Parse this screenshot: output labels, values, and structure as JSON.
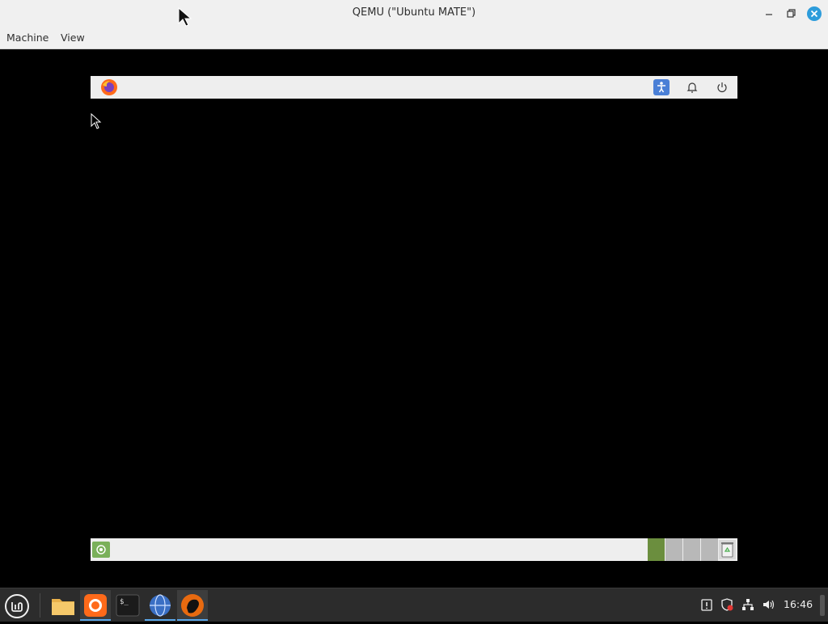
{
  "window": {
    "title": "QEMU (\"Ubuntu MATE\")"
  },
  "menubar": {
    "items": [
      {
        "label": "Machine"
      },
      {
        "label": "View"
      }
    ]
  },
  "guest": {
    "top_panel": {
      "launcher_icon": "firefox-icon",
      "indicators": [
        "accessibility-icon",
        "bell-icon",
        "power-icon"
      ]
    },
    "bottom_panel": {
      "show_desktop_icon": "show-desktop-icon",
      "workspaces": 4,
      "active_workspace": 1,
      "trash_icon": "trash-icon"
    }
  },
  "taskbar": {
    "menu_icon": "mint-menu-icon",
    "apps": [
      {
        "name": "files",
        "icon": "folder-icon",
        "active": false
      },
      {
        "name": "firefox",
        "icon": "firefox-icon",
        "active": true
      },
      {
        "name": "terminal",
        "icon": "terminal-icon",
        "active": false
      },
      {
        "name": "network",
        "icon": "network-globe-icon",
        "active": true
      },
      {
        "name": "qemu",
        "icon": "qemu-icon",
        "active": true
      }
    ],
    "tray": [
      "update-manager-icon",
      "shield-icon",
      "network-icon",
      "volume-icon"
    ],
    "clock": "16:46"
  },
  "colors": {
    "accent": "#5aa6e8",
    "close_button": "#2d9cdb",
    "mint_green": "#8bc34a",
    "workspace_active": "#6b8e3e"
  }
}
